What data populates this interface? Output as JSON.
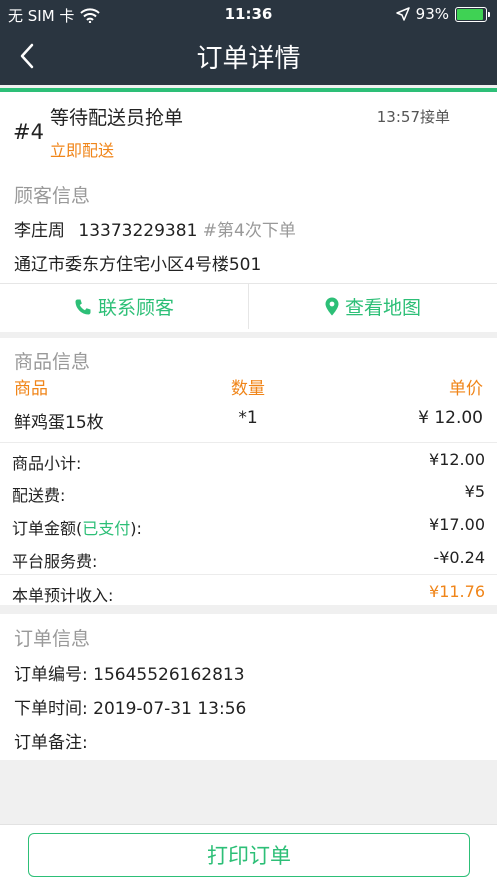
{
  "status_bar": {
    "carrier": "无 SIM 卡",
    "time": "11:36",
    "battery": "93%",
    "battery_level": 0.93
  },
  "nav": {
    "title": "订单详情"
  },
  "order": {
    "number": "#4",
    "status": "等待配送员抢单",
    "delivery_mode": "立即配送",
    "accept_time": "13:57接单"
  },
  "customer": {
    "section_title": "顾客信息",
    "name": "李庄周",
    "phone": "13373229381",
    "order_times": "#第4次下单",
    "address": "通辽市委东方住宅小区4号楼501",
    "contact_label": "联系顾客",
    "map_label": "查看地图"
  },
  "goods": {
    "section_title": "商品信息",
    "headers": {
      "name": "商品",
      "qty": "数量",
      "price": "单价"
    },
    "items": [
      {
        "name": "鲜鸡蛋15枚",
        "qty": "*1",
        "price": "¥ 12.00"
      }
    ]
  },
  "fees": {
    "subtotal_label": "商品小计:",
    "subtotal_value": "¥12.00",
    "delivery_label": "配送费:",
    "delivery_value": "¥5",
    "amount_label_pre": "订单金额(",
    "amount_paid": "已支付",
    "amount_label_post": "):",
    "amount_value": "¥17.00",
    "service_label": "平台服务费:",
    "service_value": "-¥0.24",
    "income_label": "本单预计收入:",
    "income_value": "¥11.76"
  },
  "info": {
    "section_title": "订单信息",
    "order_no": "订单编号: 15645526162813",
    "order_time": "下单时间: 2019-07-31 13:56",
    "note": "订单备注:"
  },
  "actions": {
    "print_label": "打印订单"
  },
  "colors": {
    "accent": "#2dbf77",
    "orange": "#f08519",
    "header_bg": "#2a3540"
  }
}
